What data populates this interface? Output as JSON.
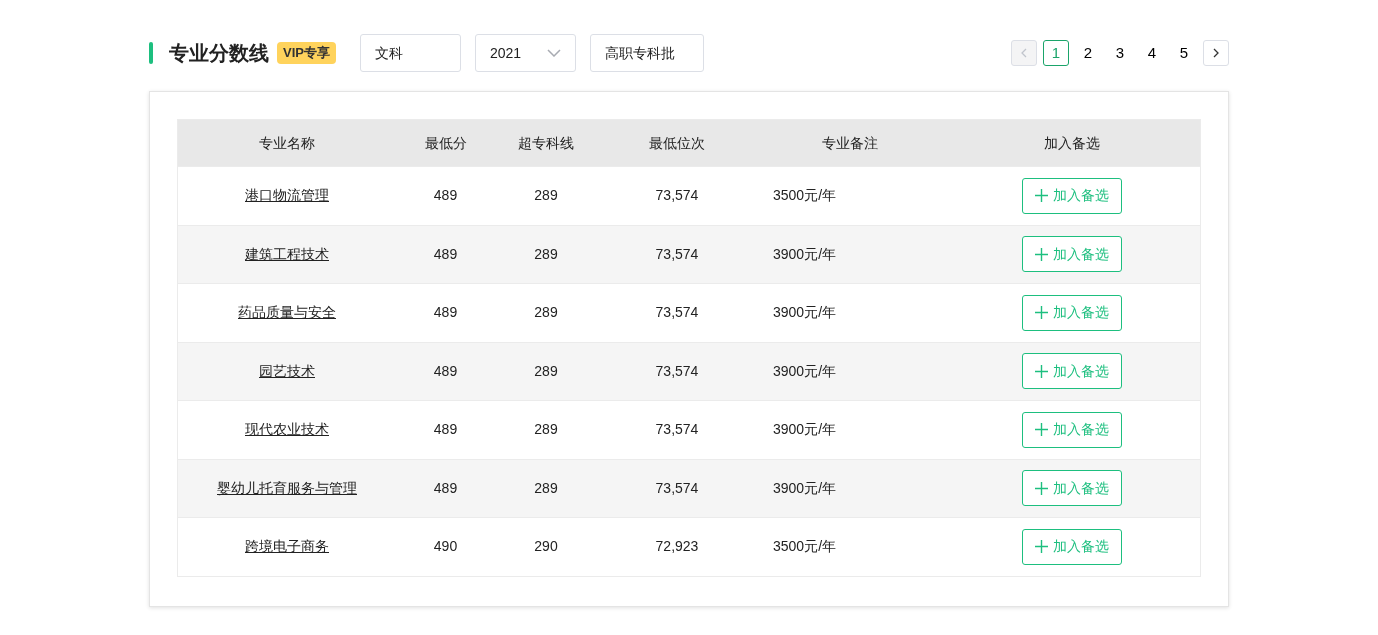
{
  "header": {
    "title": "专业分数线",
    "badge": "VIP专享"
  },
  "filters": [
    {
      "kind": "text",
      "value": "文科"
    },
    {
      "kind": "select",
      "value": "2021"
    },
    {
      "kind": "text",
      "value": "高职专科批"
    }
  ],
  "pagination": {
    "prev": {
      "disabled": true
    },
    "pages": [
      {
        "label": "1",
        "selected": true
      },
      {
        "label": "2",
        "selected": false
      },
      {
        "label": "3",
        "selected": false
      },
      {
        "label": "4",
        "selected": false
      },
      {
        "label": "5",
        "selected": false
      }
    ],
    "next": {
      "disabled": false
    }
  },
  "table": {
    "columns": [
      "专业名称",
      "最低分",
      "超专科线",
      "最低位次",
      "专业备注",
      "加入备选"
    ],
    "rows": [
      {
        "name": "港口物流管理",
        "min_score": "489",
        "above_line": "289",
        "min_rank": "73,574",
        "note": "3500元/年",
        "action": "加入备选"
      },
      {
        "name": "建筑工程技术",
        "min_score": "489",
        "above_line": "289",
        "min_rank": "73,574",
        "note": "3900元/年",
        "action": "加入备选"
      },
      {
        "name": "药品质量与安全",
        "min_score": "489",
        "above_line": "289",
        "min_rank": "73,574",
        "note": "3900元/年",
        "action": "加入备选"
      },
      {
        "name": "园艺技术",
        "min_score": "489",
        "above_line": "289",
        "min_rank": "73,574",
        "note": "3900元/年",
        "action": "加入备选"
      },
      {
        "name": "现代农业技术",
        "min_score": "489",
        "above_line": "289",
        "min_rank": "73,574",
        "note": "3900元/年",
        "action": "加入备选"
      },
      {
        "name": "婴幼儿托育服务与管理",
        "min_score": "489",
        "above_line": "289",
        "min_rank": "73,574",
        "note": "3900元/年",
        "action": "加入备选"
      },
      {
        "name": "跨境电子商务",
        "min_score": "490",
        "above_line": "290",
        "min_rank": "72,923",
        "note": "3500元/年",
        "action": "加入备选"
      }
    ]
  }
}
